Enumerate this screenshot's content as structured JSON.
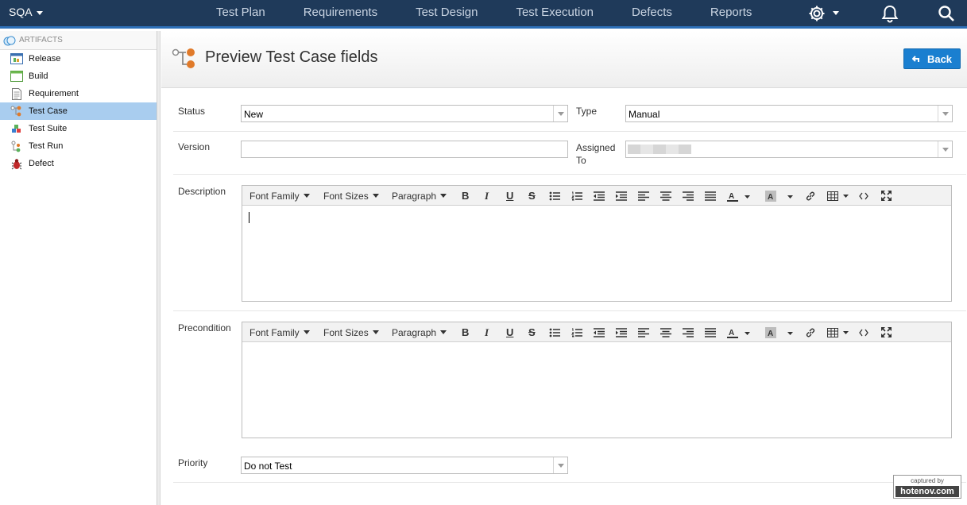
{
  "topnav": {
    "brand": "SQA",
    "links": [
      "Test Plan",
      "Requirements",
      "Test Design",
      "Test Execution",
      "Defects",
      "Reports"
    ]
  },
  "sidebar": {
    "header": "ARTIFACTS",
    "items": [
      {
        "label": "Release"
      },
      {
        "label": "Build"
      },
      {
        "label": "Requirement"
      },
      {
        "label": "Test Case"
      },
      {
        "label": "Test Suite"
      },
      {
        "label": "Test Run"
      },
      {
        "label": "Defect"
      }
    ]
  },
  "page": {
    "title": "Preview Test Case fields",
    "back_label": "Back"
  },
  "form": {
    "status_label": "Status",
    "status_value": "New",
    "type_label": "Type",
    "type_value": "Manual",
    "version_label": "Version",
    "version_value": "",
    "assigned_label_1": "Assigned",
    "assigned_label_2": "To",
    "description_label": "Description",
    "precondition_label": "Precondition",
    "priority_label": "Priority",
    "priority_value": "Do not Test"
  },
  "toolbar": {
    "font_family": "Font Family",
    "font_sizes": "Font Sizes",
    "paragraph": "Paragraph",
    "bold": "B",
    "italic": "I",
    "underline": "U",
    "strike": "S"
  },
  "watermark": {
    "line1": "captured by",
    "line2": "hotenov.com"
  },
  "colors": {
    "nav_bg": "#1f3a5a",
    "accent": "#1a7fd0",
    "active_item": "#a9cdef"
  }
}
